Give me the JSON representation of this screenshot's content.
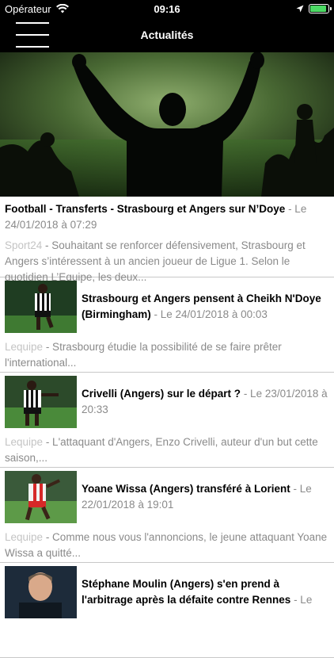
{
  "status_bar": {
    "carrier": "Opérateur",
    "time": "09:16",
    "battery_level": 0.9,
    "battery_color": "#4cd964"
  },
  "nav": {
    "title": "Actualités",
    "menu_icon": "hamburger-menu-icon"
  },
  "hero": {
    "image": "celebrating-fan-silhouette-stadium"
  },
  "articles": [
    {
      "title": "Football - Transferts - Strasbourg et Angers sur N’Doye",
      "date": " - Le 24/01/2018 à 07:29",
      "source": "Sport24",
      "summary": " - Souhaitant se renforcer défensivement, Strasbourg et Angers s’intéressent à un ancien joueur de Ligue 1. Selon le quotidien L’Equipe, les deux..."
    },
    {
      "title": "Strasbourg et Angers pensent à Cheikh N'Doye (Birmingham)",
      "date": " - Le 24/01/2018 à 00:03",
      "source": "Lequipe",
      "summary": " - Strasbourg étudie la possibilité de se faire prêter l'international...",
      "thumb": "player-striped-jersey-thumbnail"
    },
    {
      "title": "Crivelli (Angers) sur le départ ?",
      "date": " - Le 23/01/2018 à 20:33",
      "source": "Lequipe",
      "summary": " - L'attaquant d'Angers, Enzo Crivelli, auteur d'un but cette saison,...",
      "thumb": "player-striped-jersey-thumbnail"
    },
    {
      "title": "Yoane Wissa (Angers) transféré à Lorient",
      "date": " - Le 22/01/2018 à 19:01",
      "source": "Lequipe",
      "summary": " - Comme nous vous l'annoncions, le jeune attaquant Yoane Wissa a quitté...",
      "thumb": "player-red-white-kit-thumbnail"
    },
    {
      "title": "Stéphane Moulin (Angers) s'en prend à l'arbitrage après la défaite contre Rennes",
      "date": " - Le",
      "thumb": "coach-portrait-thumbnail"
    }
  ]
}
